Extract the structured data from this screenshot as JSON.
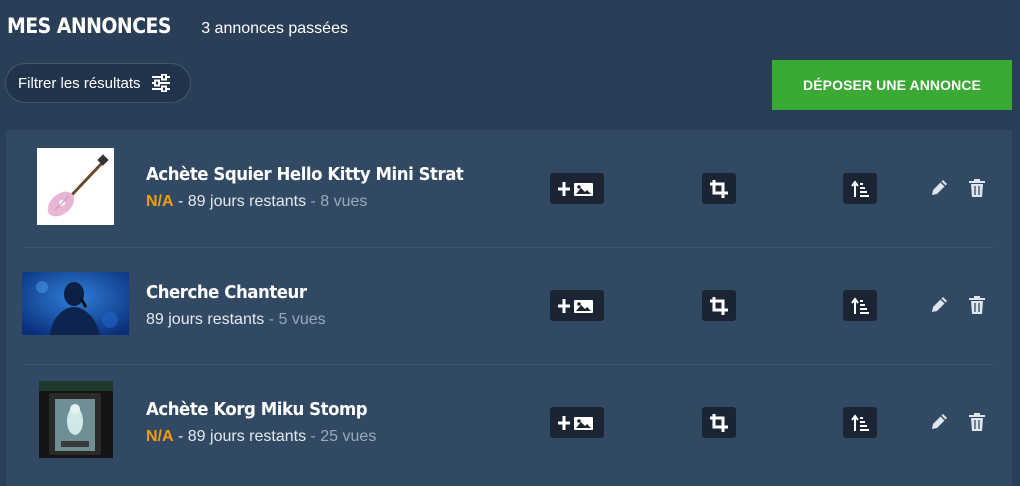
{
  "header": {
    "title": "MES ANNONCES",
    "count": "3 annonces passées"
  },
  "toolbar": {
    "filter_label": "Filtrer les résultats",
    "post_label": "DÉPOSER UNE ANNONCE"
  },
  "colors": {
    "background": "#2b3e57",
    "panel": "#324963",
    "accent_green": "#3aaa35",
    "na_orange": "#f39c12",
    "action_bg": "#1a2433"
  },
  "listings": [
    {
      "title": "Achète Squier Hello Kitty Mini Strat",
      "price": "N/A",
      "sep1": " - ",
      "days": "89 jours restants",
      "sep2": " - ",
      "views": "8 vues",
      "image": "pink-guitar-thumbnail"
    },
    {
      "title": "Cherche Chanteur",
      "days": "89 jours restants",
      "sep2": " - ",
      "views": "5 vues",
      "image": "singer-photo-thumbnail"
    },
    {
      "title": "Achète Korg Miku Stomp",
      "price": "N/A",
      "sep1": " - ",
      "days": "89 jours restants",
      "sep2": " - ",
      "views": "25 vues",
      "image": "pedal-photo-thumbnail"
    }
  ],
  "row_actions": [
    "add-photo-icon",
    "crop-icon",
    "sort-up-icon",
    "pencil-icon",
    "trash-icon"
  ]
}
